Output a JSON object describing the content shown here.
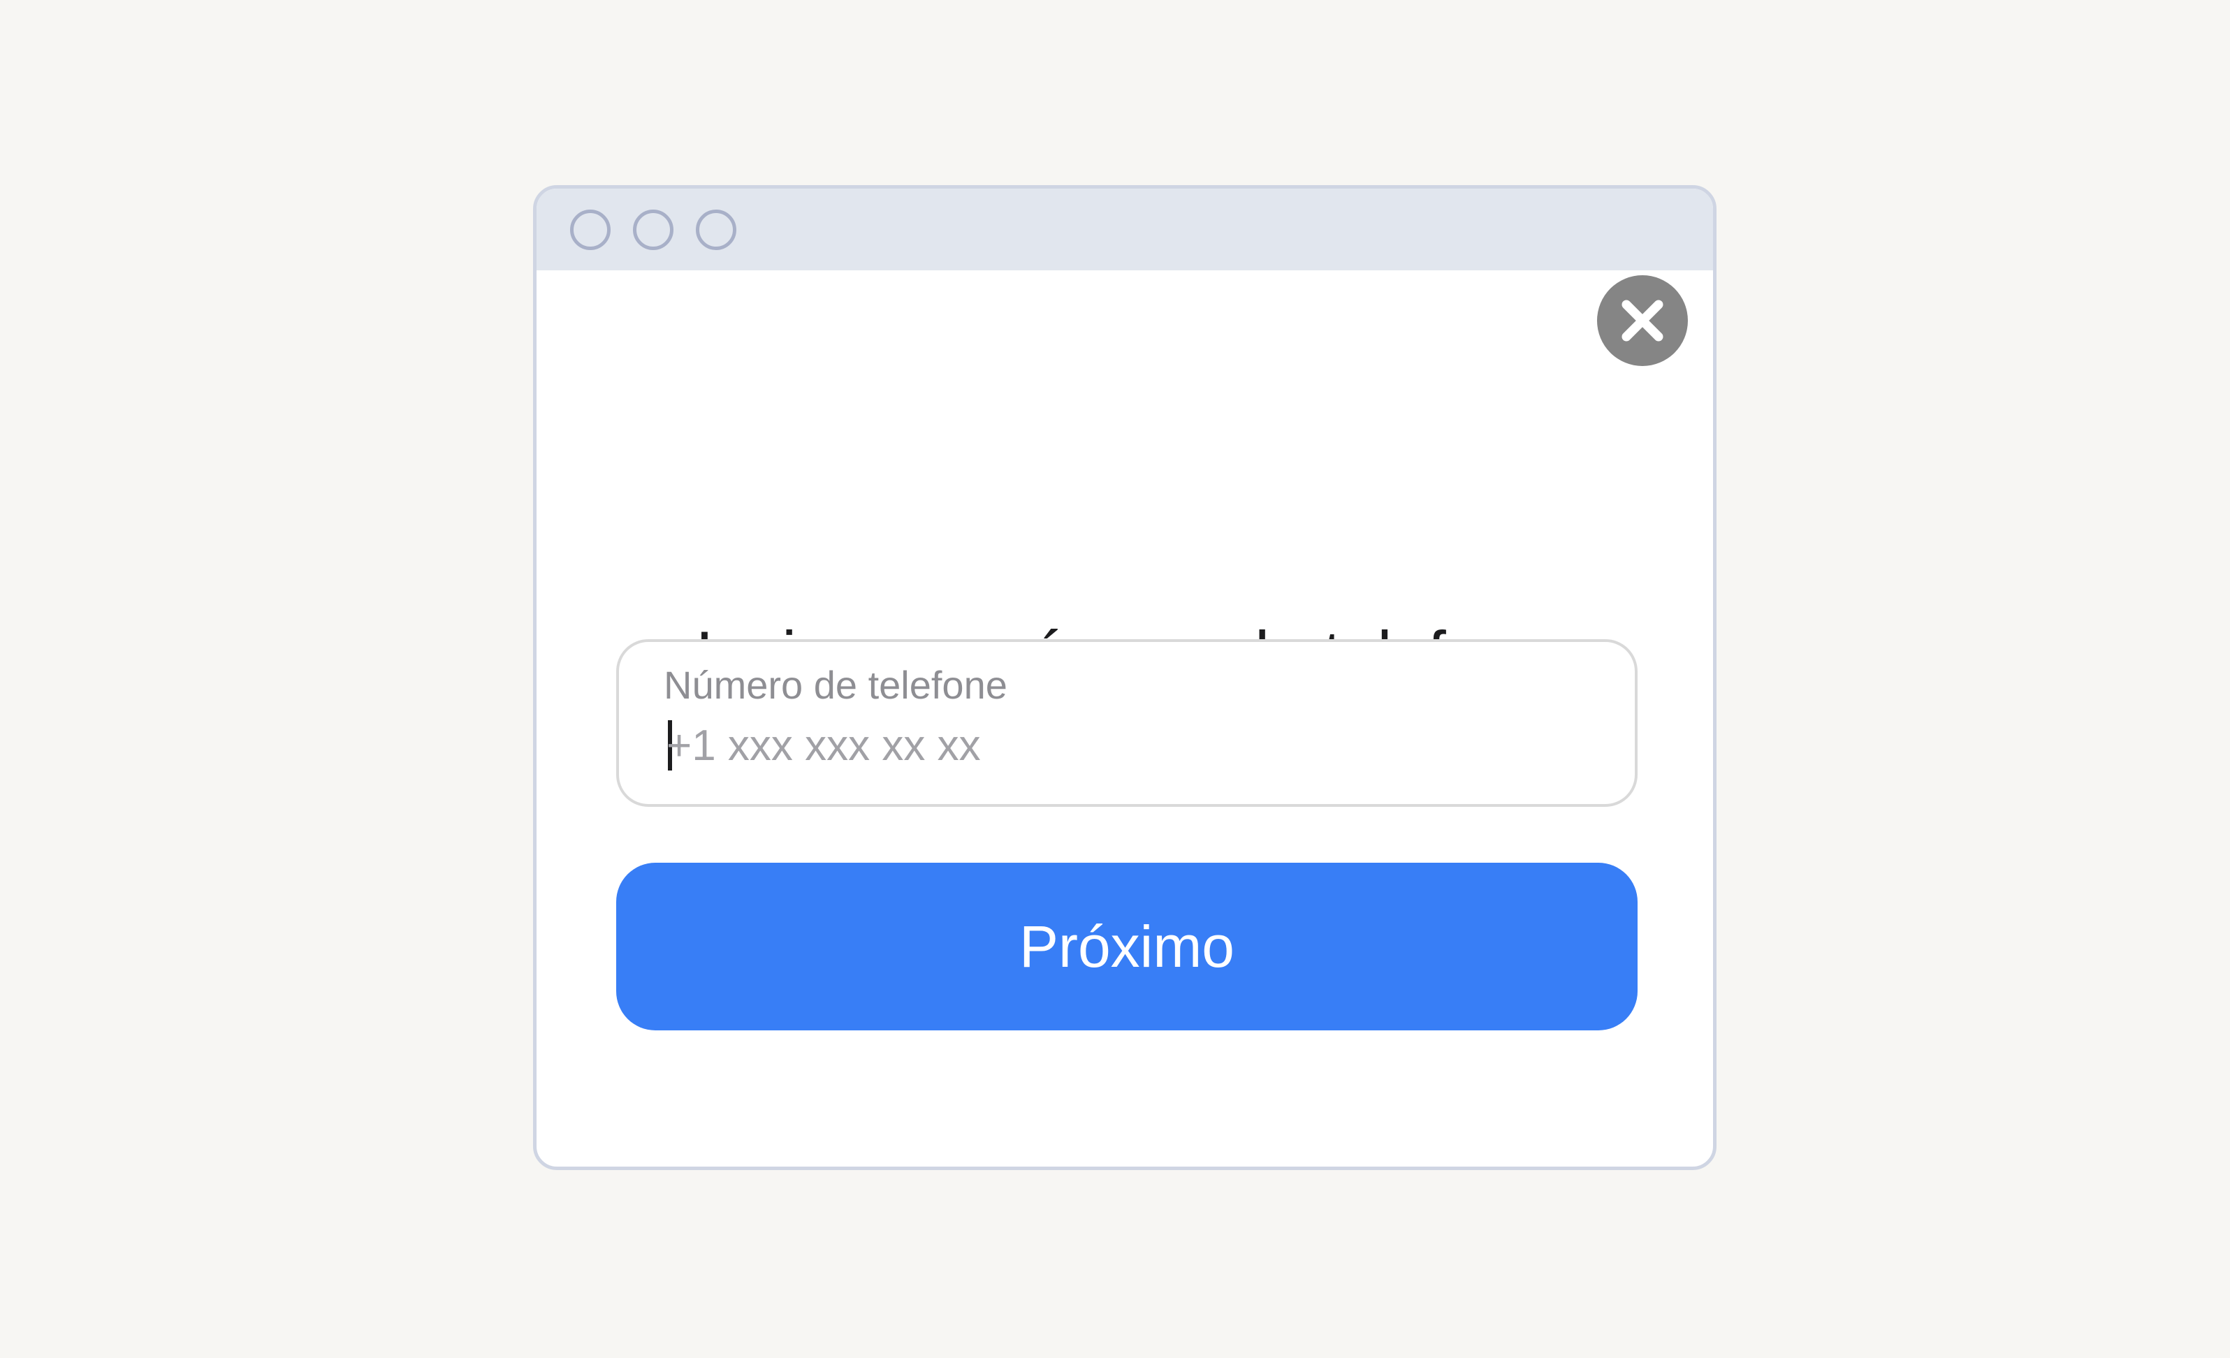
{
  "window": {
    "controls": [
      "traffic-light-1",
      "traffic-light-2",
      "traffic-light-3"
    ]
  },
  "dialog": {
    "close_icon": "close-icon",
    "title": "Insira seu número de telefone",
    "phone_field": {
      "label": "Número de telefone",
      "placeholder": "+1 xxx xxx xx xx",
      "value": ""
    },
    "next_button_label": "Próximo"
  },
  "colors": {
    "page_background": "#f7f6f3",
    "titlebar": "#e1e6ee",
    "window_border": "#cfd5e3",
    "close_button": "#858585",
    "primary_button": "#387ef6"
  }
}
